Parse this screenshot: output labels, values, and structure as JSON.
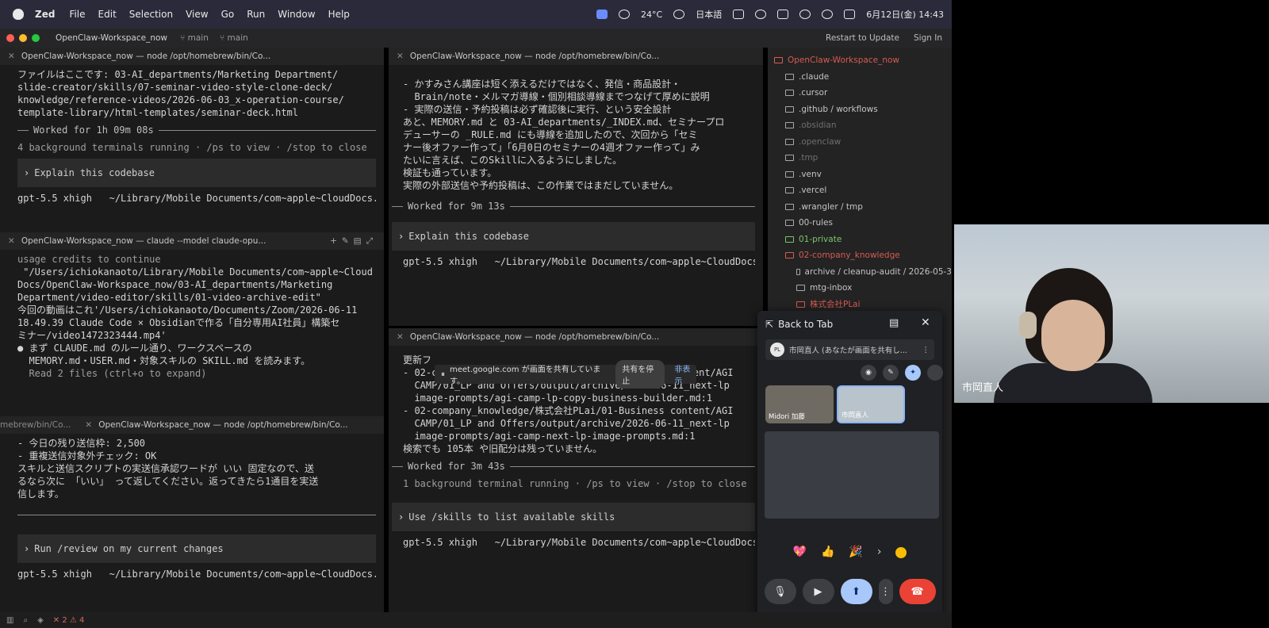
{
  "menubar": {
    "app": "Zed",
    "items": [
      "File",
      "Edit",
      "Selection",
      "View",
      "Go",
      "Run",
      "Window",
      "Help"
    ],
    "weather": "24°C",
    "input_mode": "日本語",
    "datetime": "6月12日(金)  14:43"
  },
  "titlebar": {
    "project": "OpenClaw-Workspace_now",
    "branch1": "main",
    "branch2": "main",
    "restart": "Restart to Update",
    "signin": "Sign In"
  },
  "pane_tl": {
    "tab": "OpenClaw-Workspace_now — node /opt/homebrew/bin/Co...",
    "lines": [
      "ファイルはここです: 03-AI_departments/Marketing Department/",
      "slide-creator/skills/07-seminar-video-style-clone-deck/",
      "knowledge/reference-videos/2026-06-03_x-operation-course/",
      "template-library/html-templates/seminar-deck.html"
    ],
    "worked": "Worked for 1h 09m 08s",
    "bg": "4 background terminals running · /ps to view · /stop to close",
    "prompt": "Explain this codebase",
    "model": "gpt-5.5 xhigh   ~/Library/Mobile Documents/com~apple~CloudDocs."
  },
  "pane_ml": {
    "tab": "OpenClaw-Workspace_now — claude --model claude-opu...",
    "lines": [
      "usage credits to continue",
      "",
      " \"/Users/ichiokanaoto/Library/Mobile Documents/com~apple~Cloud",
      "Docs/OpenClaw-Workspace_now/03-AI_departments/Marketing",
      "Department/video-editor/skills/01-video-archive-edit\"",
      "今回の動画はこれ'/Users/ichiokanaoto/Documents/Zoom/2026-06-11",
      "18.49.39 Claude Code × Obsidianで作る「自分専用AI社員」構築セ",
      "ミナー/video1472323444.mp4'",
      "",
      "● まず CLAUDE.md のルール通り、ワークスペースの",
      "  MEMORY.md・USER.md・対象スキルの SKILL.md を読みます。",
      "",
      "  Read 2 files (ctrl+o to expand)"
    ]
  },
  "pane_bl": {
    "tab_left": "mebrew/bin/Co...",
    "tab": "OpenClaw-Workspace_now — node /opt/homebrew/bin/Co...",
    "lines": [
      "- 今日の残り送信枠: 2,500",
      "- 重複送信対象外チェック: OK",
      "",
      "スキルと送信スクリプトの実送信承認ワードが いい 固定なので、送",
      "るなら次に 「いい」 って返してください。返ってきたら1通目を実送",
      "信します。"
    ],
    "prompt": "Run /review on my current changes",
    "model": "gpt-5.5 xhigh   ~/Library/Mobile Documents/com~apple~CloudDocs."
  },
  "pane_tr": {
    "tab": "OpenClaw-Workspace_now — node /opt/homebrew/bin/Co...",
    "lines": [
      "- かすみさん講座は短く添えるだけではなく、発信・商品設計・",
      "  Brain/note・メルマガ導線・個別相談導線までつなげて厚めに説明",
      "",
      "- 実際の送信・予約投稿は必ず確認後に実行、という安全設計",
      "",
      "あと、MEMORY.md と 03-AI_departments/_INDEX.md、セミナープロ",
      "デューサーの _RULE.md にも導線を追加したので、次回から「セミ",
      "ナー後オファー作って」「6月0日のセミナーの4週オファー作って」み",
      "たいに言えば、このSkillに入るようにしました。",
      "",
      "検証も通っています。",
      "実際の外部送信や予約投稿は、この作業ではまだしていません。"
    ],
    "worked": "Worked for 9m 13s",
    "prompt": "Explain this codebase",
    "model": "gpt-5.5 xhigh   ~/Library/Mobile Documents/com~apple~CloudDocs."
  },
  "pane_br": {
    "tab": "OpenClaw-Workspace_now — node /opt/homebrew/bin/Co...",
    "lines": [
      "更新フ",
      "",
      "- 02-company_knowledge/株式会社PLai/01-Business content/AGI",
      "  CAMP/01_LP and Offers/output/archive/2026-06-11_next-lp",
      "  image-prompts/agi-camp-lp-copy-business-builder.md:1",
      "",
      "- 02-company_knowledge/株式会社PLai/01-Business content/AGI",
      "  CAMP/01_LP and Offers/output/archive/2026-06-11_next-lp",
      "  image-prompts/agi-camp-next-lp-image-prompts.md:1",
      "",
      "検索でも 105本 や旧配分は残っていません。"
    ],
    "worked": "Worked for 3m 43s",
    "bg": "1 background terminal running · /ps to view · /stop to close",
    "prompt": "Use /skills to list available skills",
    "model": "gpt-5.5 xhigh   ~/Library/Mobile Documents/com~apple~CloudDocs."
  },
  "sidebar": {
    "items": [
      {
        "label": "OpenClaw-Workspace_now",
        "state": "red",
        "indent": 0
      },
      {
        "label": ".claude",
        "state": "normal",
        "indent": 1
      },
      {
        "label": ".cursor",
        "state": "normal",
        "indent": 1
      },
      {
        "label": ".github / workflows",
        "state": "normal",
        "indent": 1
      },
      {
        "label": ".obsidian",
        "state": "muted",
        "indent": 1
      },
      {
        "label": ".openclaw",
        "state": "muted",
        "indent": 1
      },
      {
        "label": ".tmp",
        "state": "muted",
        "indent": 1
      },
      {
        "label": ".venv",
        "state": "normal",
        "indent": 1
      },
      {
        "label": ".vercel",
        "state": "normal",
        "indent": 1
      },
      {
        "label": ".wrangler / tmp",
        "state": "normal",
        "indent": 1
      },
      {
        "label": "00-rules",
        "state": "normal",
        "indent": 1
      },
      {
        "label": "01-private",
        "state": "green",
        "indent": 1
      },
      {
        "label": "02-company_knowledge",
        "state": "red",
        "indent": 1
      },
      {
        "label": "archive / cleanup-audit / 2026-05-3",
        "state": "normal",
        "indent": 2
      },
      {
        "label": "mtg-inbox",
        "state": "normal",
        "indent": 2
      },
      {
        "label": "株式会社PLai",
        "state": "red",
        "indent": 2
      }
    ]
  },
  "meet": {
    "back": "Back to Tab",
    "tab_title": "市岡直人 (あなたが画面を共有し...",
    "avatar": "PL",
    "thumb1": "Midori 加藤",
    "thumb2": "市岡直人",
    "reactions": [
      "💖",
      "👍",
      "🎉"
    ]
  },
  "sharebar": {
    "text": "meet.google.com が画面を共有しています。",
    "stop": "共有を停止",
    "hide": "非表示"
  },
  "webcam": {
    "name": "市岡直人"
  },
  "statusbar": {
    "errors": "2",
    "warnings": "4"
  }
}
